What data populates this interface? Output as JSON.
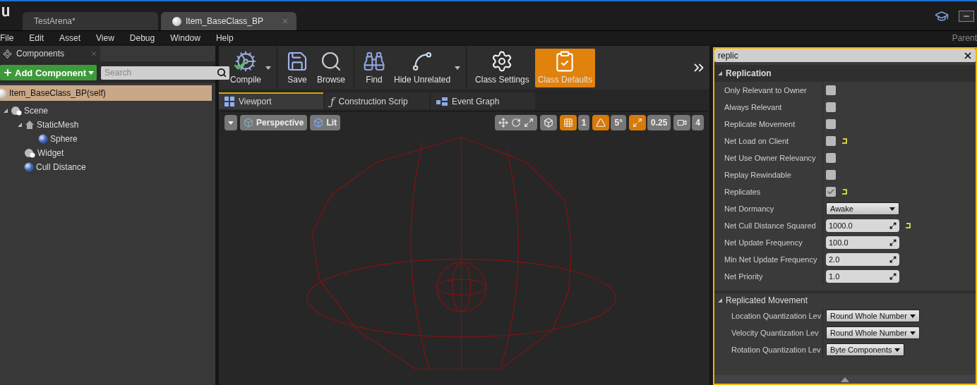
{
  "doc_tabs": [
    {
      "label": "TestArena*",
      "selected": false,
      "closable": false
    },
    {
      "label": "Item_BaseClass_BP",
      "selected": true,
      "closable": true
    }
  ],
  "menu": [
    "File",
    "Edit",
    "Asset",
    "View",
    "Debug",
    "Window",
    "Help"
  ],
  "parent_label": "Parent",
  "components": {
    "title": "Components",
    "add_button": "Add Component",
    "search": {
      "placeholder": "Search"
    },
    "self": "Item_BaseClass_BP(self)",
    "tree": [
      {
        "label": "Scene",
        "kind": "scene",
        "expanded": true,
        "children": [
          {
            "label": "StaticMesh",
            "kind": "mesh",
            "expanded": true,
            "children": [
              {
                "label": "Sphere",
                "kind": "sphere",
                "expanded": false
              }
            ]
          },
          {
            "label": "Widget",
            "kind": "scene",
            "expanded": false
          },
          {
            "label": "Cull Distance",
            "kind": "sphere",
            "expanded": false
          }
        ]
      }
    ]
  },
  "toolbar": {
    "groups": [
      [
        {
          "label": "Compile",
          "selected": false,
          "menu": true
        }
      ],
      [
        {
          "label": "Save",
          "selected": false,
          "menu": false
        },
        {
          "label": "Browse",
          "selected": false,
          "menu": false
        }
      ],
      [
        {
          "label": "Find",
          "selected": false,
          "menu": false
        },
        {
          "label": "Hide Unrelated",
          "selected": false,
          "menu": true
        }
      ],
      [
        {
          "label": "Class Settings",
          "selected": false,
          "menu": false
        },
        {
          "label": "Class Defaults",
          "selected": true,
          "menu": false
        }
      ]
    ]
  },
  "editor_tabs": [
    {
      "label": "Viewport",
      "selected": true
    },
    {
      "label": "Construction Scrip",
      "glyph": "ƒ",
      "selected": false
    },
    {
      "label": "Event Graph",
      "selected": false
    }
  ],
  "viewport_toolbar": {
    "view": "Perspective",
    "mode": "Lit",
    "snaps": [
      {
        "kind": "grid",
        "value": "1",
        "active": true
      },
      {
        "kind": "angle",
        "value": "5°",
        "active": true
      },
      {
        "kind": "scale",
        "value": "0.25",
        "active": true
      },
      {
        "kind": "camera",
        "value": "4",
        "active": false
      }
    ]
  },
  "details": {
    "search": "replic",
    "sections": [
      {
        "title": "Replication",
        "expanded": true,
        "rows": [
          {
            "label": "Only Relevant to Owner",
            "kind": "checkbox",
            "checked": false,
            "reset": false
          },
          {
            "label": "Always Relevant",
            "kind": "checkbox",
            "checked": false,
            "reset": false
          },
          {
            "label": "Replicate Movement",
            "kind": "checkbox",
            "checked": false,
            "reset": false
          },
          {
            "label": "Net Load on Client",
            "kind": "checkbox",
            "checked": false,
            "reset": true
          },
          {
            "label": "Net Use Owner Relevancy",
            "kind": "checkbox",
            "checked": false,
            "reset": false
          },
          {
            "label": "Replay Rewindable",
            "kind": "checkbox",
            "checked": false,
            "reset": false
          },
          {
            "label": "Replicates",
            "kind": "checkbox",
            "checked": true,
            "reset": true
          },
          {
            "label": "Net Dormancy",
            "kind": "dropdown",
            "value": "Awake",
            "reset": false
          },
          {
            "label": "Net Cull Distance Squared",
            "kind": "number",
            "value": "1000.0",
            "reset": true
          },
          {
            "label": "Net Update Frequency",
            "kind": "number",
            "value": "100.0",
            "reset": false
          },
          {
            "label": "Min Net Update Frequency",
            "kind": "number",
            "value": "2.0",
            "reset": false
          },
          {
            "label": "Net Priority",
            "kind": "number",
            "value": "1.0",
            "reset": false
          }
        ]
      },
      {
        "title": "Replicated Movement",
        "expanded": true,
        "rows": [
          {
            "label": "Location Quantization Lev",
            "kind": "enum",
            "value": "Round Whole Number",
            "reset": false
          },
          {
            "label": "Velocity Quantization Lev",
            "kind": "enum",
            "value": "Round Whole Number",
            "reset": false
          },
          {
            "label": "Rotation Quantization Lev",
            "kind": "enum",
            "value": "Byte Components",
            "reset": false
          }
        ]
      }
    ]
  }
}
